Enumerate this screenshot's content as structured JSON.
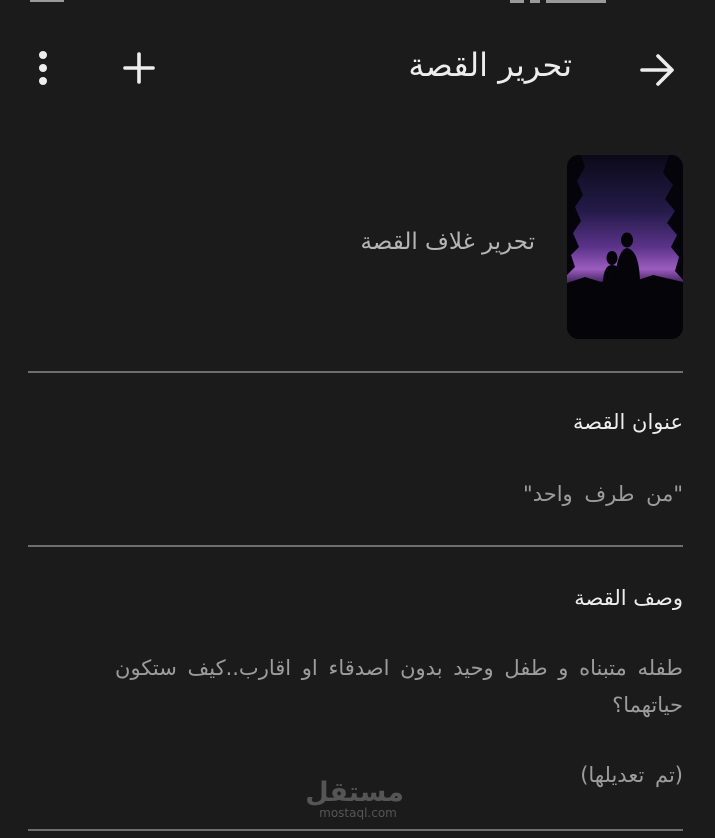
{
  "toolbar": {
    "title": "تحرير القصة",
    "back_icon": "arrow-right-icon",
    "add_icon": "plus-icon",
    "more_icon": "more-vertical-icon"
  },
  "cover": {
    "label": "تحرير غلاف القصة"
  },
  "title_field": {
    "label": "عنوان القصة",
    "value": "\"من طرف واحد\""
  },
  "description_field": {
    "label": "وصف القصة",
    "value": "طفله متبناه و طفل وحيد بدون اصدقاء او اقارب..كيف ستكون حياتهما؟",
    "note": "(تم تعديلها)"
  },
  "watermark": {
    "arabic": "مستقل",
    "latin": "mostaql.com"
  },
  "colors": {
    "background": "#1b1b1b",
    "primary_text": "#ededed",
    "secondary_text": "#9c9c9c",
    "divider": "#6e6e6e"
  }
}
